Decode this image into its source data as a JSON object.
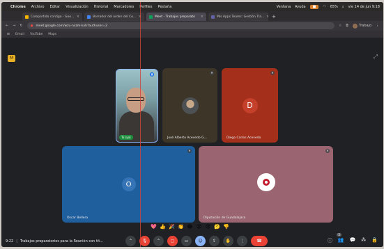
{
  "menubar": {
    "app": "Chrome",
    "items": [
      "Archivo",
      "Editar",
      "Visualización",
      "Historial",
      "Marcadores",
      "Perfiles",
      "Pestaña"
    ],
    "right": [
      "Ventana",
      "Ayuda"
    ],
    "battery": "65%",
    "datetime": "vie 14 de jun 9:18"
  },
  "tabs": [
    {
      "label": "Compartido contigo - Goo...",
      "color": "#f4b400",
      "active": false
    },
    {
      "label": "Borrador del orden del Co...",
      "color": "#4285f4",
      "active": false
    },
    {
      "label": "Meet - Trabajos preparato",
      "color": "#0f9d58",
      "active": true
    },
    {
      "label": "Mis Apps Teams: Gestión Tra...",
      "color": "#6264a7",
      "active": false
    }
  ],
  "new_tab": "+",
  "address": {
    "url": "meet.google.com/wzu-nxzm-kxh?authuser=2",
    "profile": "Trabajo"
  },
  "bookmarks": [
    "Gmail",
    "YouTube",
    "Maps"
  ],
  "meet": {
    "logo": "M",
    "participants": [
      {
        "id": "self",
        "name": "",
        "badge": "Tú (yo)"
      },
      {
        "id": "jose",
        "name": "José Alberto Acevedo G..."
      },
      {
        "id": "diego",
        "name": "Diego Carlos Acevedo",
        "initial": "D"
      },
      {
        "id": "oscar",
        "name": "Oscar Bellera",
        "initial": "O"
      },
      {
        "id": "diputacion",
        "name": "Diputación de Guadalajara"
      }
    ],
    "reactions": [
      "💖",
      "👍",
      "🎉",
      "👏",
      "😂",
      "😮",
      "😢",
      "🤔",
      "👎"
    ],
    "bottom": {
      "time": "9:22",
      "separator": "|",
      "title": "Trabajos preparatorios para la Reunión con tit..."
    },
    "participant_count": "5"
  }
}
